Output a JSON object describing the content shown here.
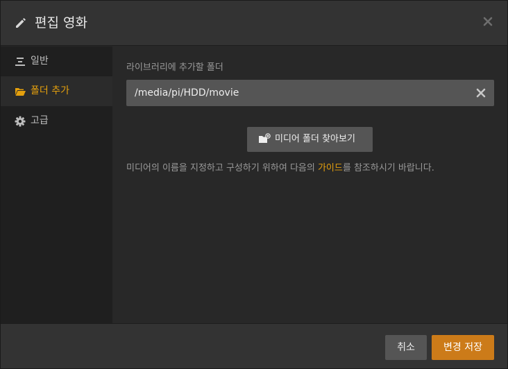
{
  "dialog": {
    "title": "편집 영화",
    "title_icon": "pencil-icon",
    "close_icon": "close-icon"
  },
  "sidebar": {
    "items": [
      {
        "label": "일반",
        "icon": "list-icon",
        "active": false
      },
      {
        "label": "폴더 추가",
        "icon": "folder-open-icon",
        "active": true
      },
      {
        "label": "고급",
        "icon": "gear-icon",
        "active": false
      }
    ]
  },
  "content": {
    "field_label": "라이브러리에 추가할 폴더",
    "path_value": "/media/pi/HDD/movie",
    "clear_icon": "clear-icon",
    "browse_label": "미디어 폴더 찾아보기",
    "browse_icon": "folder-add-icon",
    "help_prefix": "미디어의 이름을 지정하고 구성하기 위하여 다음의 ",
    "help_link": "가이드",
    "help_suffix": "를 참조하시기 바랍니다."
  },
  "footer": {
    "cancel_label": "취소",
    "save_label": "변경 저장"
  },
  "colors": {
    "accent": "#e5a00d",
    "save_button": "#cc7b19",
    "background": "#282828",
    "sidebar": "#1f1f1f"
  }
}
